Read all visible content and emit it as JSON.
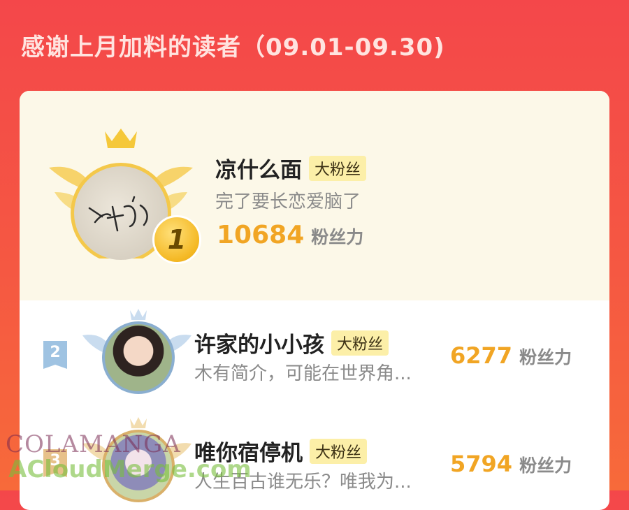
{
  "header": {
    "title": "感谢上月加料的读者（09.01-09.30)"
  },
  "ranking": [
    {
      "rank": "1",
      "name": "凉什么面",
      "badge": "大粉丝",
      "bio": "完了要长恋爱脑了",
      "score": "10684",
      "score_unit": "粉丝力",
      "avatar_signature": "凉面"
    },
    {
      "rank": "2",
      "name": "许家的小小孩",
      "badge": "大粉丝",
      "bio": "木有简介，可能在世界角...",
      "score": "6277",
      "score_unit": "粉丝力"
    },
    {
      "rank": "3",
      "name": "唯你宿停机",
      "badge": "大粉丝",
      "bio": "人生百古谁无乐？唯我为...",
      "score": "5794",
      "score_unit": "粉丝力"
    }
  ],
  "watermark": {
    "line1": "COLAMANGA",
    "line2": "ACloudMerge.com"
  },
  "colors": {
    "background": "#f4474a",
    "score": "#f1a524",
    "badge": "#fcefa8",
    "card_top": "#fcf8e8"
  }
}
